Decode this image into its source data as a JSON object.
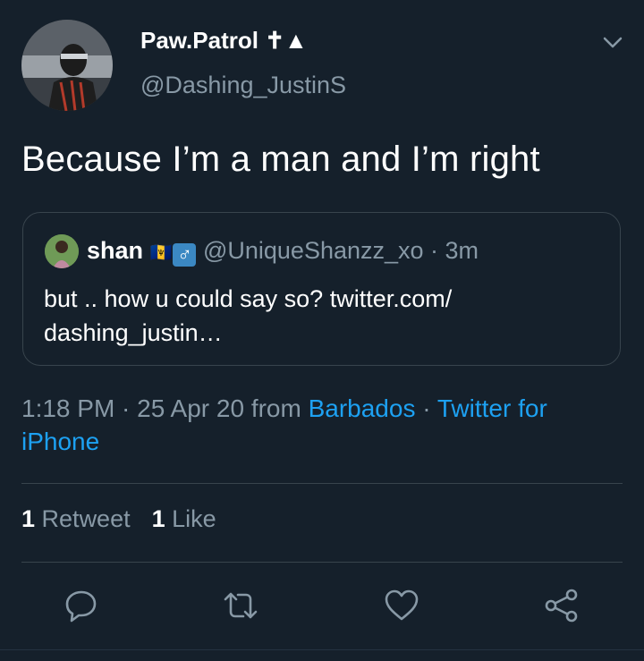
{
  "theme": {
    "background": "#15202b",
    "text_primary": "#ffffff",
    "text_secondary": "#8899a6",
    "accent_link": "#1da1f2",
    "border": "#38444d"
  },
  "author": {
    "display_name": "Paw.Patrol ✝▲",
    "handle": "@Dashing_JustinS",
    "avatar_icon": "user-avatar"
  },
  "tweet": {
    "text": "Because I’m a man and I’m right"
  },
  "quoted_tweet": {
    "name": "shan",
    "emoji": "🇧🇧",
    "male_sign": "♂",
    "handle_time": "@UniqueShanzz_xo · 3m",
    "text": "but .. how u could say so? twitter.com/ dashing_justin…"
  },
  "meta": {
    "time_date_prefix": "1:18 PM · 25 Apr 20 from ",
    "location": "Barbados",
    "separator": " · ",
    "source": "Twitter for iPhone"
  },
  "stats": {
    "retweet_count": "1",
    "retweet_label": "Retweet",
    "like_count": "1",
    "like_label": "Like"
  },
  "actions": {
    "icons": [
      "reply-icon",
      "retweet-icon",
      "like-icon",
      "share-icon"
    ]
  }
}
